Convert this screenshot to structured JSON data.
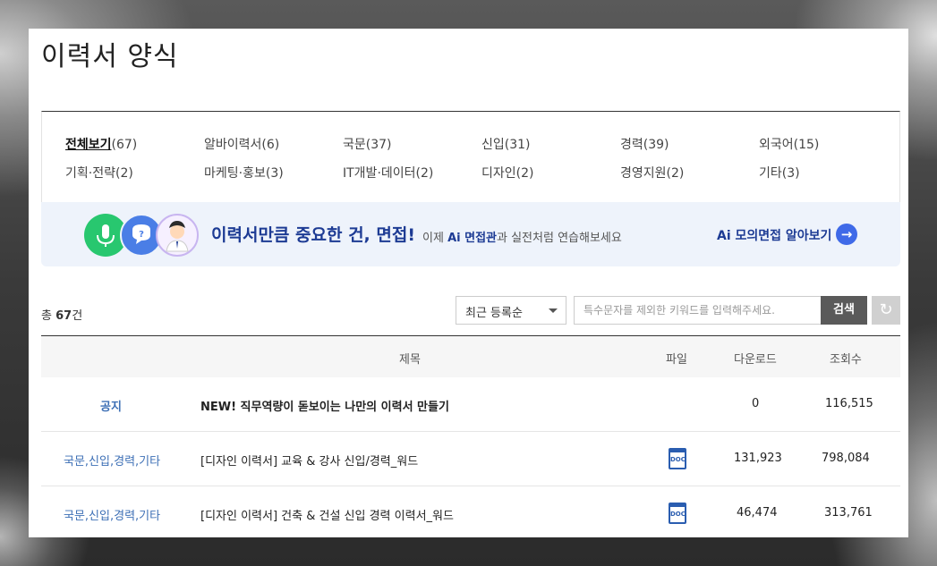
{
  "page": {
    "title": "이력서 양식"
  },
  "categories": [
    {
      "label": "전체보기",
      "count": "(67)",
      "active": true
    },
    {
      "label": "알바이력서",
      "count": "(6)"
    },
    {
      "label": "국문",
      "count": "(37)"
    },
    {
      "label": "신입",
      "count": "(31)"
    },
    {
      "label": "경력",
      "count": "(39)"
    },
    {
      "label": "외국어",
      "count": "(15)"
    },
    {
      "label": "기획·전략",
      "count": "(2)"
    },
    {
      "label": "마케팅·홍보",
      "count": "(3)"
    },
    {
      "label": "IT개발·데이터",
      "count": "(2)"
    },
    {
      "label": "디자인",
      "count": "(2)"
    },
    {
      "label": "경영지원",
      "count": "(2)"
    },
    {
      "label": "기타",
      "count": "(3)"
    }
  ],
  "banner": {
    "headline": "이력서만큼 중요한 건, 면접!",
    "sub_prefix": "이제 ",
    "sub_bold": "Ai 면접관",
    "sub_suffix": "과 실전처럼 연습해보세요",
    "link_label": "Ai 모의면접 알아보기",
    "icons": [
      "microphone-icon",
      "question-bubble-icon",
      "interviewer-avatar"
    ],
    "colors": {
      "mic": "#28c76f",
      "bubble": "#4a7ee6",
      "accent": "#1d3b94"
    }
  },
  "toolbar": {
    "total_prefix": "총 ",
    "total_count": "67",
    "total_suffix": "건",
    "sort_value": "최근 등록순",
    "search_placeholder": "특수문자를 제외한 키워드를 입력해주세요.",
    "search_label": "검색",
    "reset_icon": "↻"
  },
  "table": {
    "headers": {
      "title": "제목",
      "file": "파일",
      "downloads": "다운로드",
      "views": "조회수"
    },
    "rows": [
      {
        "category": "공지",
        "title": "NEW! 직무역량이 돋보이는 나만의 이력서 만들기",
        "file": "",
        "downloads": "0",
        "views": "116,515"
      },
      {
        "category": "국문,신입,경력,기타",
        "title": "[디자인 이력서] 교육 & 강사 신입/경력_워드",
        "file": "DOC",
        "downloads": "131,923",
        "views": "798,084"
      },
      {
        "category": "국문,신입,경력,기타",
        "title": "[디자인 이력서] 건축 & 건설 신입 경력 이력서_워드",
        "file": "DOC",
        "downloads": "46,474",
        "views": "313,761"
      }
    ]
  }
}
